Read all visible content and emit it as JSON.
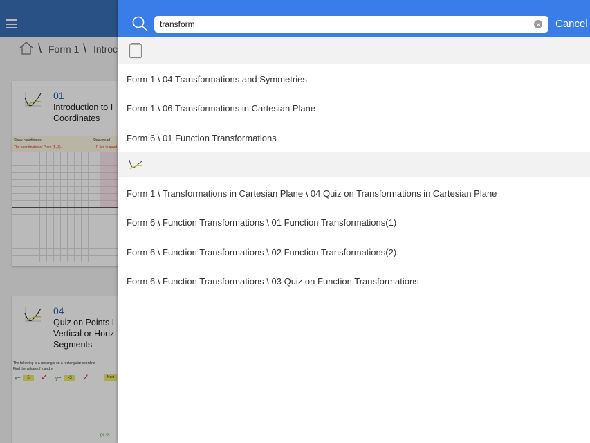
{
  "background": {
    "breadcrumb": [
      "Form 1",
      "Introc"
    ],
    "cards": [
      {
        "number": "01",
        "title": "Introduction to I Coordinates",
        "graph": {
          "show_coordinates": "Show coordinates",
          "coord_text": "The coordinates of P are (5, 3).",
          "show_quadrant": "Show quad",
          "quadrant_text": "P lies in quad"
        }
      },
      {
        "number": "04",
        "title": "Quiz on Points L Vertical or Horiz Segments",
        "quiz": {
          "prompt": "The following is a rectangle on a rectangular coordina",
          "find": "Find the values of x and y.",
          "x_label": "x=",
          "x_value": "5",
          "y_label": "y=",
          "y_value": "-3",
          "next_label": "Next",
          "point_label": "(x, 0)"
        }
      }
    ]
  },
  "search": {
    "query": "transform",
    "cancel_label": "Cancel"
  },
  "sections": [
    {
      "icon": "book-icon",
      "results": [
        "Form 1 \\ 04 Transformations and Symmetries",
        "Form 1 \\ 06 Transformations in Cartesian Plane",
        "Form 6 \\ 01 Function Transformations"
      ]
    },
    {
      "icon": "graph-icon",
      "results": [
        "Form 1 \\ Transformations in Cartesian Plane \\ 04 Quiz on Transformations in Cartesian Plane",
        "Form 6 \\ Function Transformations \\ 01 Function Transformations(1)",
        "Form 6 \\ Function Transformations \\ 02 Function Transformations(2)",
        "Form 6 \\ Function Transformations \\ 03 Quiz on Function Transformations"
      ]
    }
  ],
  "colors": {
    "header_blue": "#3b7de8",
    "background_header": "#3a6fb8"
  }
}
